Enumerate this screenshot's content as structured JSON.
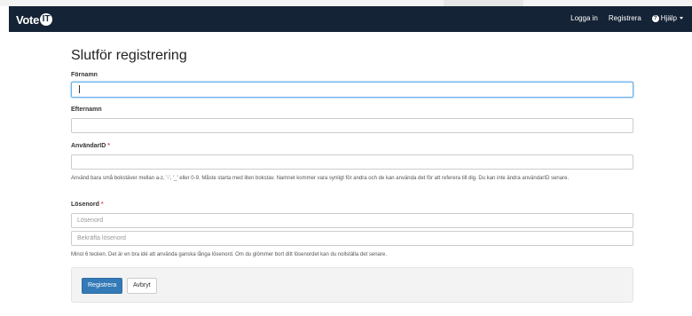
{
  "colors": {
    "navbar_bg": "#152336",
    "primary": "#337ab7",
    "required": "#d9534f",
    "focus_border": "#66afe9"
  },
  "navbar": {
    "brand": "Vote",
    "brand_badge": "IT",
    "links": {
      "login": "Logga in",
      "register": "Registrera",
      "help": "Hjälp"
    },
    "help_icon": "question-circle-icon"
  },
  "form": {
    "title": "Slutför registrering",
    "firstname": {
      "label": "Förnamn",
      "value": ""
    },
    "lastname": {
      "label": "Efternamn",
      "value": ""
    },
    "userid": {
      "label": "AnvändarID",
      "required_mark": "*",
      "value": "",
      "help": "Använd bara små bokstäver mellan a-z, '-', '_' eller 0-9. Måste starta med liten bokstav. Namnet kommer vara synligt för andra och de kan använda det för att referera till dig. Du kan inte ändra användarID senare."
    },
    "password": {
      "label": "Lösenord",
      "required_mark": "*",
      "placeholder": "Lösenord",
      "confirm_placeholder": "Bekräfta lösenord",
      "help": "Minst 6 tecken. Det är en bra idé att använda ganska långa lösenord. Om du glömmer bort ditt lösenordet kan du nollställa det senare."
    },
    "buttons": {
      "submit": "Registrera",
      "cancel": "Avbryt"
    }
  }
}
